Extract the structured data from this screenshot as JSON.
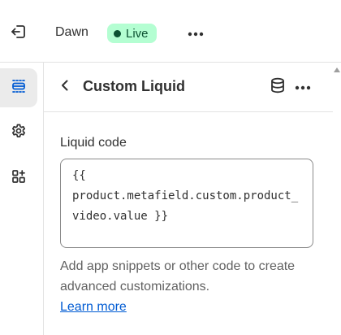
{
  "topbar": {
    "exit_icon": "exit-icon",
    "theme_name": "Dawn",
    "status_badge": "Live",
    "more_icon": "more-horizontal-icon"
  },
  "sidenav": {
    "items": [
      {
        "icon": "sections-icon",
        "active": true
      },
      {
        "icon": "settings-gear-icon",
        "active": false
      },
      {
        "icon": "apps-icon",
        "active": false
      }
    ]
  },
  "panel": {
    "title": "Custom Liquid",
    "back_icon": "chevron-left-icon",
    "database_icon": "database-icon",
    "more_icon": "more-horizontal-icon",
    "field_label": "Liquid code",
    "code_value": "{{\nproduct.metafield.custom.product_video.value }}",
    "help_text": "Add app snippets or other code to create advanced customizations.",
    "help_link": "Learn more"
  },
  "colors": {
    "badge_bg": "#b4fed2",
    "badge_text": "#0c5132",
    "link": "#005bd3",
    "active_nav_bg": "#ebebeb"
  }
}
